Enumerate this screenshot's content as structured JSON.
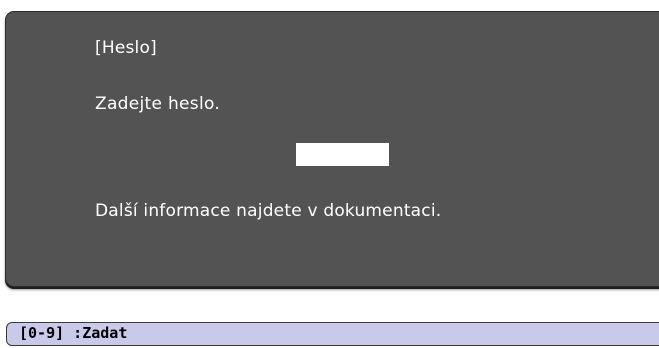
{
  "dialog": {
    "title": "[Heslo]",
    "prompt": "Zadejte heslo.",
    "password_value": "",
    "info": "Další informace najdete v dokumentaci."
  },
  "hint_bar": {
    "text": "[0-9] :Zadat"
  },
  "colors": {
    "dialog_background": "#535353",
    "dialog_text": "#ffffff",
    "input_background": "#ffffff",
    "hint_bar_background": "#c9c9ea"
  }
}
